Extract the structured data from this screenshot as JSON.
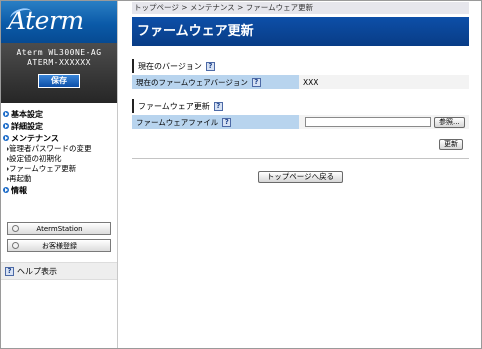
{
  "sidebar": {
    "logo_text": "Aterm",
    "model_line1": "Aterm WL300NE-AG",
    "model_line2": "ATERM-XXXXXX",
    "save_label": "保存",
    "nav": {
      "basic": "基本設定",
      "detail": "詳細設定",
      "maintenance": "メンテナンス",
      "maintenance_items": [
        "管理者パスワードの変更",
        "設定値の初期化",
        "ファームウェア更新",
        "再起動"
      ],
      "info": "情報"
    },
    "buttons": [
      "AtermStation",
      "お客様登録"
    ],
    "help_label": "ヘルプ表示"
  },
  "main": {
    "breadcrumb": "トップページ > メンテナンス > ファームウェア更新",
    "title": "ファームウェア更新",
    "current_version": {
      "heading": "現在のバージョン",
      "label": "現在のファームウェアバージョン",
      "value": "XXX"
    },
    "firmware_update": {
      "heading": "ファームウェア更新",
      "label": "ファームウェアファイル",
      "file_value": "",
      "browse_label": "参照...",
      "update_label": "更新"
    },
    "back_label": "トップページへ戻る"
  },
  "icons": {
    "help": "?"
  },
  "colors": {
    "brand_blue": "#0d4fa8",
    "label_bg": "#b8d4ee"
  }
}
